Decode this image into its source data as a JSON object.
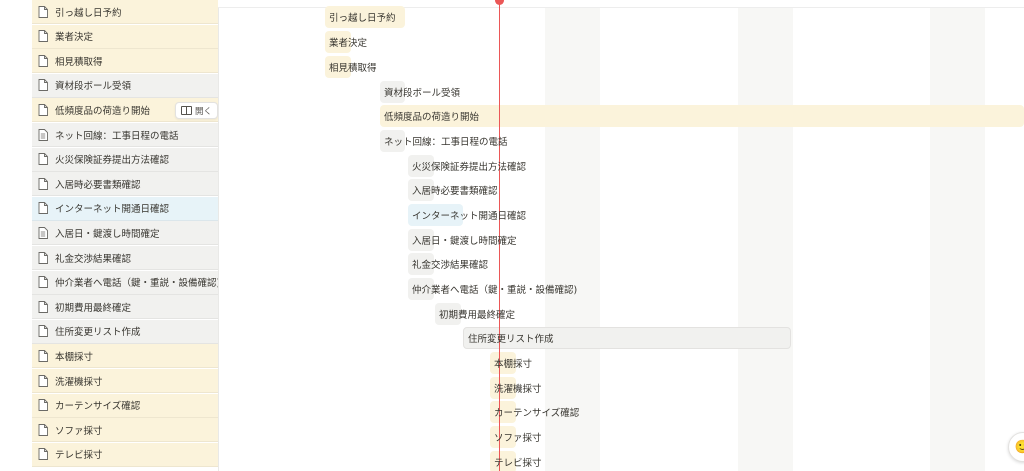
{
  "colors": {
    "yellow_row": "#fbf3db",
    "gray_row": "#f1f1ef",
    "blue_row": "#e7f3f8",
    "today_line": "#eb5757"
  },
  "list": {
    "open_label": "開く",
    "items": [
      {
        "label": "引っ越し日予約",
        "color": "yellow",
        "icon": "page-icon"
      },
      {
        "label": "業者決定",
        "color": "yellow",
        "icon": "page-icon"
      },
      {
        "label": "相見積取得",
        "color": "yellow",
        "icon": "page-icon"
      },
      {
        "label": "資材段ボール受領",
        "color": "gray",
        "icon": "page-icon"
      },
      {
        "label": "低頻度品の荷造り開始",
        "color": "yellow",
        "icon": "page-icon"
      },
      {
        "label": "ネット回線：工事日程の電話",
        "color": "gray",
        "icon": "document-icon"
      },
      {
        "label": "火災保険証券提出方法確認",
        "color": "gray",
        "icon": "page-icon"
      },
      {
        "label": "入居時必要書類確認",
        "color": "gray",
        "icon": "page-icon"
      },
      {
        "label": "インターネット開通日確認",
        "color": "blue",
        "icon": "page-icon"
      },
      {
        "label": "入居日・鍵渡し時間確定",
        "color": "gray",
        "icon": "document-icon"
      },
      {
        "label": "礼金交渉結果確認",
        "color": "gray",
        "icon": "page-icon"
      },
      {
        "label": "仲介業者へ電話（鍵・重説・設備確認)",
        "color": "gray",
        "icon": "page-icon"
      },
      {
        "label": "初期費用最終確定",
        "color": "gray",
        "icon": "page-icon"
      },
      {
        "label": "住所変更リスト作成",
        "color": "gray",
        "icon": "page-icon"
      },
      {
        "label": "本棚採寸",
        "color": "yellow",
        "icon": "page-icon"
      },
      {
        "label": "洗濯機採寸",
        "color": "yellow",
        "icon": "page-icon"
      },
      {
        "label": "カーテンサイズ確認",
        "color": "yellow",
        "icon": "page-icon"
      },
      {
        "label": "ソファ採寸",
        "color": "yellow",
        "icon": "page-icon"
      },
      {
        "label": "テレビ採寸",
        "color": "yellow",
        "icon": "page-icon"
      }
    ]
  },
  "timeline": {
    "bars": [
      {
        "label": "引っ越し日予約"
      },
      {
        "label": "業者決定"
      },
      {
        "label": "相見積取得"
      },
      {
        "label": "資材段ボール受領"
      },
      {
        "label": "低頻度品の荷造り開始"
      },
      {
        "label": "ネット回線：工事日程の電話"
      },
      {
        "label": "火災保険証券提出方法確認"
      },
      {
        "label": "入居時必要書類確認"
      },
      {
        "label": "インターネット開通日確認"
      },
      {
        "label": "入居日・鍵渡し時間確定"
      },
      {
        "label": "礼金交渉結果確認"
      },
      {
        "label": "仲介業者へ電話（鍵・重説・設備確認)"
      },
      {
        "label": "初期費用最終確定"
      },
      {
        "label": "住所変更リスト作成"
      },
      {
        "label": "本棚採寸"
      },
      {
        "label": "洗濯機採寸"
      },
      {
        "label": "カーテンサイズ確認"
      },
      {
        "label": "ソファ採寸"
      },
      {
        "label": "テレビ採寸"
      }
    ]
  }
}
